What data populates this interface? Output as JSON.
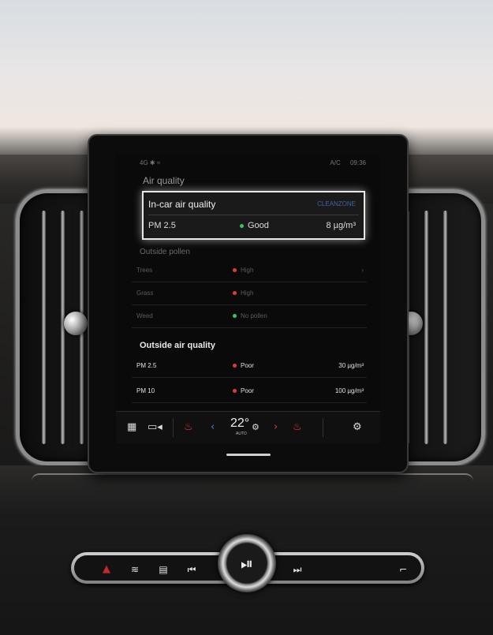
{
  "screen": {
    "status_left": "4G ✱ ≈",
    "status_right_a": "A/C",
    "status_right_b": "09:36",
    "title": "Air quality",
    "incar": {
      "title": "In-car air quality",
      "link": "CLEANZONE",
      "label": "PM 2.5",
      "status": "Good",
      "value": "8 µg/m³"
    },
    "pollen": {
      "heading": "Outside pollen",
      "rows": [
        {
          "name": "Trees",
          "status": "High",
          "chevron": "›"
        },
        {
          "name": "Grass",
          "status": "High",
          "chevron": ""
        },
        {
          "name": "Weed",
          "status": "No pollen",
          "chevron": ""
        }
      ]
    },
    "outside": {
      "heading": "Outside air quality",
      "rows": [
        {
          "name": "PM 2.5",
          "status": "Poor",
          "value": "30 µg/m³"
        },
        {
          "name": "PM 10",
          "status": "Poor",
          "value": "100 µg/m³"
        }
      ]
    },
    "climate": {
      "temp": "22°",
      "mode": "AUTO",
      "fan_icon": "⚙"
    }
  },
  "icons": {
    "grid": "▦",
    "camera": "▭◂",
    "seat_heat_left": "♨",
    "left_arrow": "‹",
    "right_arrow": "›",
    "seat_heat_right": "♨",
    "settings": "⚙",
    "hazard": "▲",
    "defrost_front": "≋",
    "defrost_rear": "▤",
    "prev": "⏮",
    "playpause": "⏯",
    "next": "⏭",
    "seat": "⌐"
  },
  "colors": {
    "good": "#34c759",
    "poor": "#e23a3a",
    "link": "#3a63a8"
  }
}
